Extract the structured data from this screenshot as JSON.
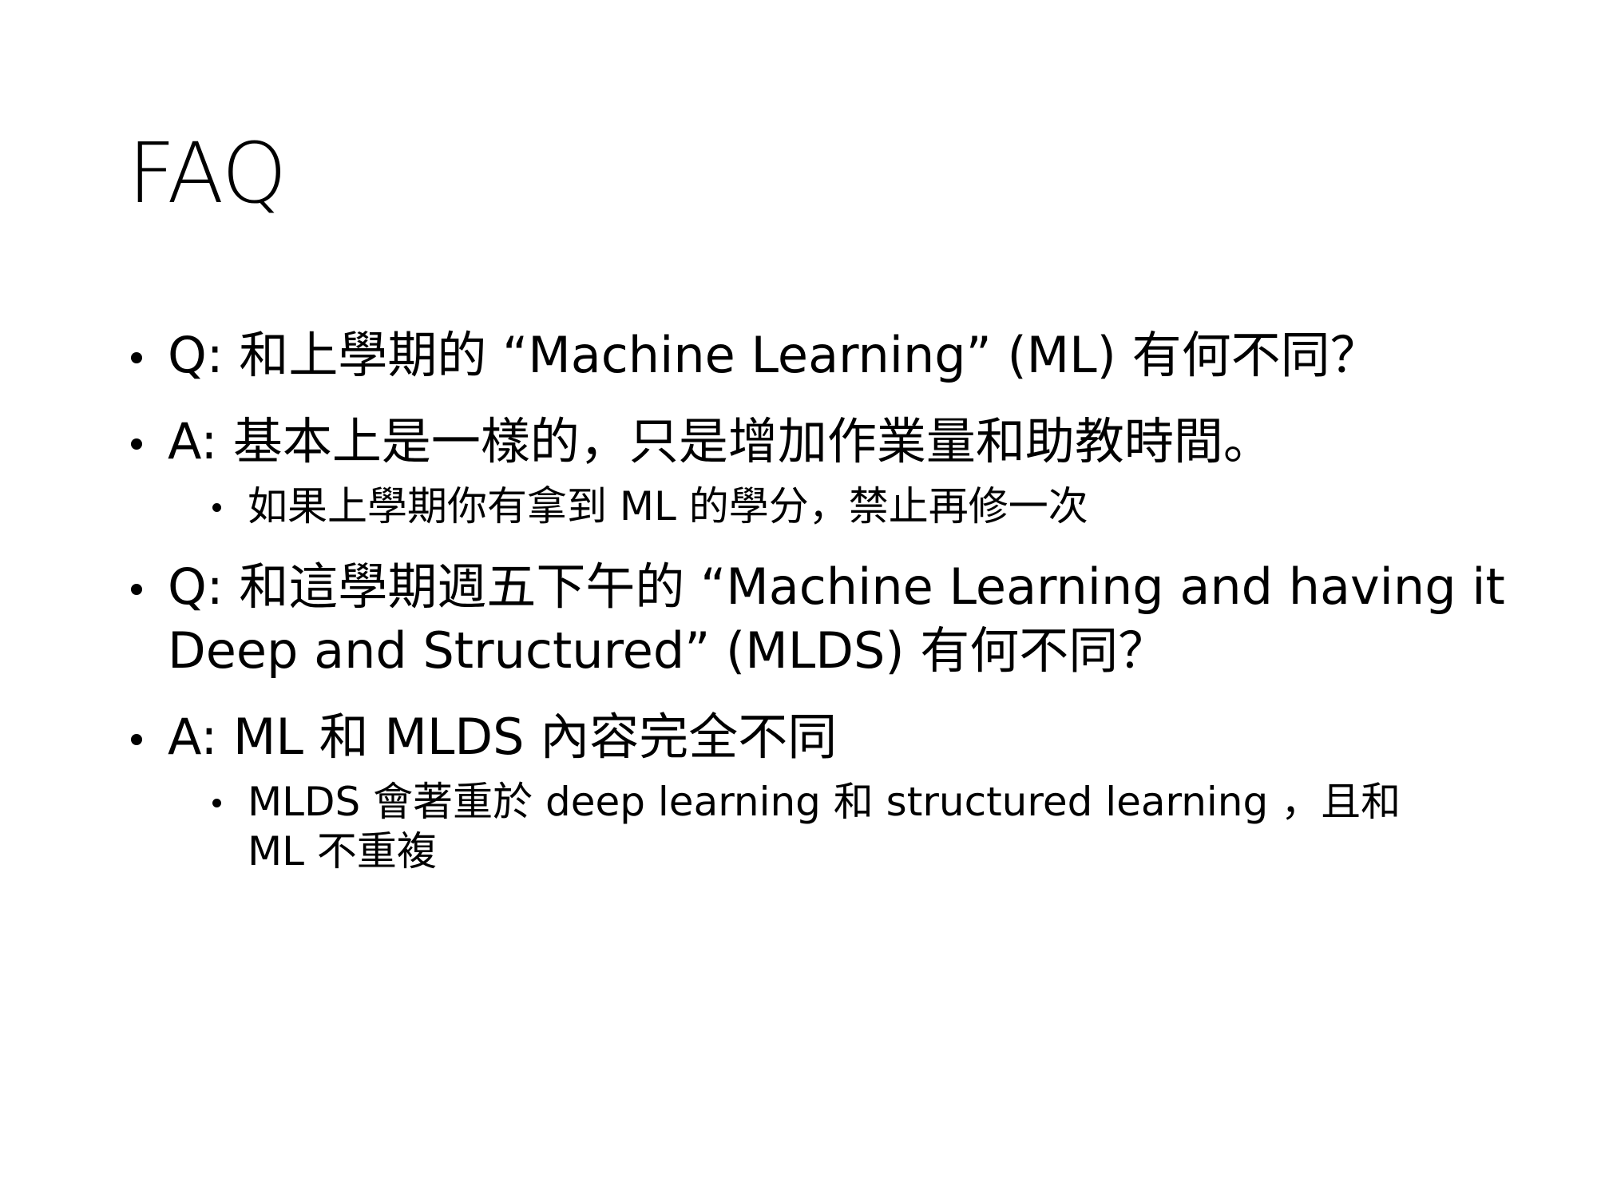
{
  "slide": {
    "title": "FAQ",
    "items": [
      {
        "level": 1,
        "text": "Q: 和上學期的 “Machine Learning” (ML) 有何不同？"
      },
      {
        "level": 1,
        "text": "A: 基本上是一樣的，只是增加作業量和助教時間。"
      },
      {
        "level": 2,
        "text": "如果上學期你有拿到 ML 的學分，禁止再修一次"
      },
      {
        "level": 1,
        "text": "Q: 和這學期週五下午的 “Machine Learning and having it Deep and Structured” (MLDS) 有何不同？"
      },
      {
        "level": 1,
        "text": "A: ML 和 MLDS 內容完全不同"
      },
      {
        "level": 2,
        "text": "MLDS 會著重於 deep learning 和 structured learning ，且和 ML 不重複"
      }
    ]
  }
}
